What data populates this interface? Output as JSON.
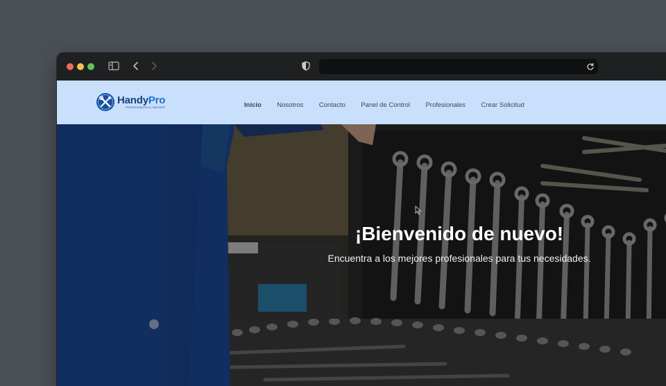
{
  "browser": {
    "address": "",
    "icons": [
      "sidebar-icon",
      "back-icon",
      "forward-icon",
      "shield-icon",
      "reload-icon"
    ]
  },
  "site": {
    "logo": {
      "name_main": "Handy",
      "name_accent": "Pro",
      "tagline": "PROFESIONALES AL INSTANTE"
    },
    "nav": [
      {
        "label": "Inicio",
        "active": true
      },
      {
        "label": "Nosotros",
        "active": false
      },
      {
        "label": "Contacto",
        "active": false
      },
      {
        "label": "Panel de Control",
        "active": false
      },
      {
        "label": "Profesionales",
        "active": false
      },
      {
        "label": "Crear Solicitud",
        "active": false
      }
    ],
    "hero": {
      "title": "¡Bienvenido de nuevo!",
      "subtitle": "Encuentra a los mejores profesionales para tus necesidades."
    }
  },
  "colors": {
    "navbar_bg": "#c8e0fb",
    "brand_dark": "#1b3f7e",
    "brand_accent": "#1b6fd0"
  }
}
